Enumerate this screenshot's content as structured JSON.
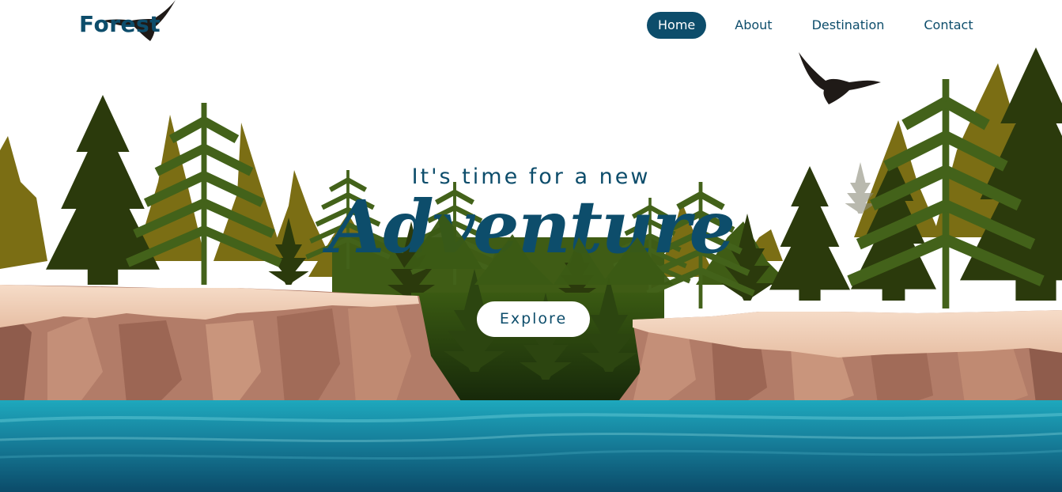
{
  "brand": {
    "logo_text": "Forest"
  },
  "nav": {
    "items": [
      {
        "label": "Home",
        "active": true
      },
      {
        "label": "About",
        "active": false
      },
      {
        "label": "Destination",
        "active": false
      },
      {
        "label": "Contact",
        "active": false
      }
    ]
  },
  "hero": {
    "tagline": "It's time for a new",
    "headline": "Adventure",
    "cta_label": "Explore"
  },
  "colors": {
    "brand_blue": "#0d4d6b",
    "water_top": "#1fa3b8",
    "water_bottom": "#0b4b69",
    "cliff_top": "#f2d3bf",
    "cliff_face": "#b07a66",
    "tree_olive": "#7a6d12",
    "tree_dark": "#2f3d0c",
    "tree_green": "#3d5a14",
    "bird": "#1f1a17"
  },
  "icons": [
    "eagle-icon"
  ]
}
